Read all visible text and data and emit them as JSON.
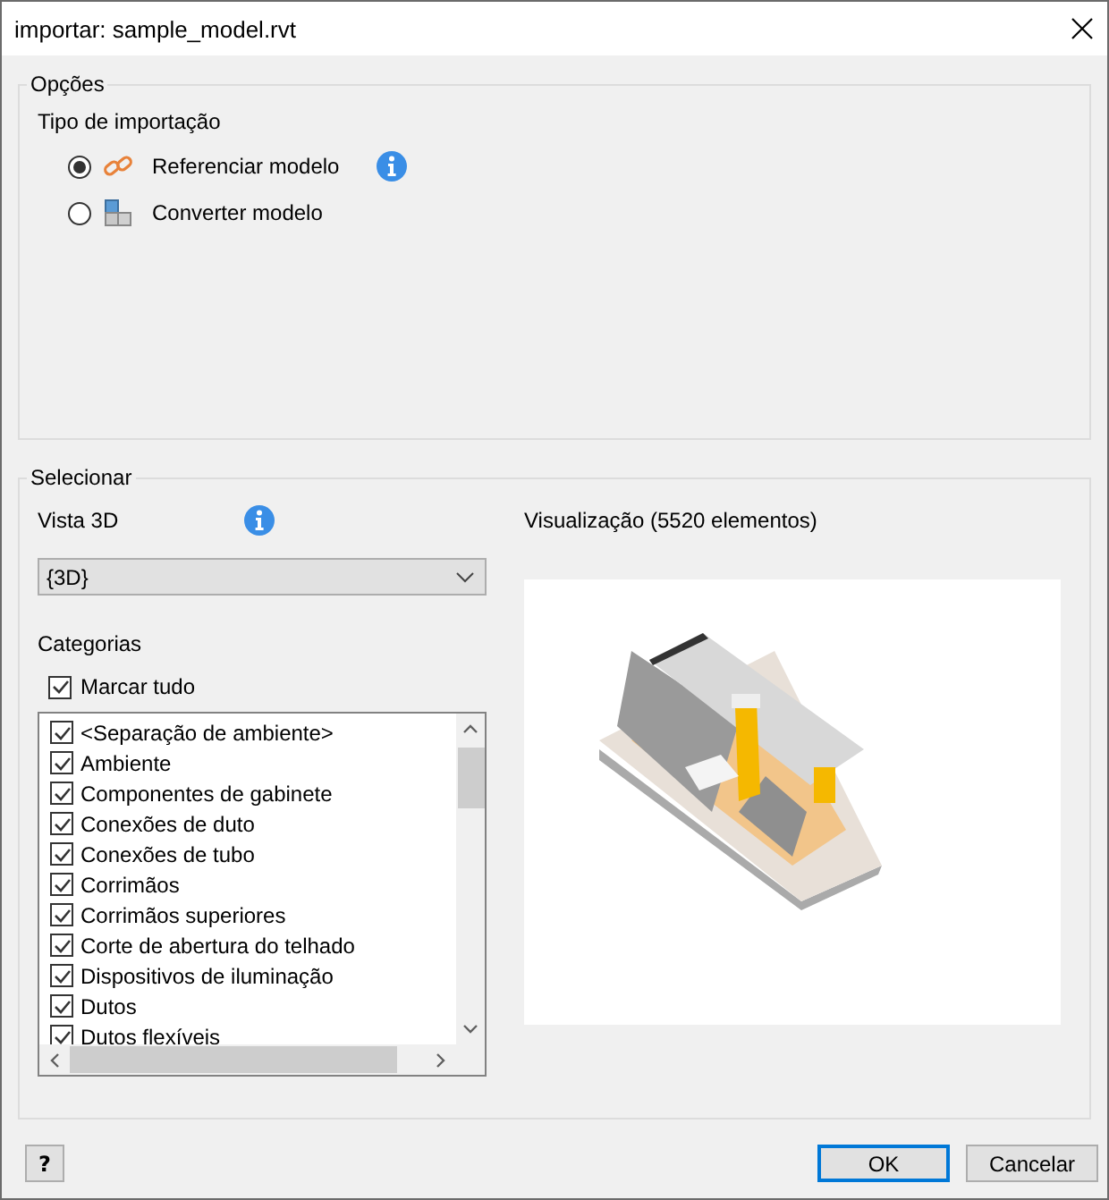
{
  "window": {
    "title": "importar: sample_model.rvt"
  },
  "options": {
    "title": "Opções",
    "import_type": {
      "label": "Tipo de importação",
      "choices": [
        {
          "label": "Referenciar modelo",
          "selected": true,
          "kind": "link",
          "info": true
        },
        {
          "label": "Converter modelo",
          "selected": false,
          "kind": "blocks",
          "info": false
        }
      ]
    }
  },
  "select": {
    "title": "Selecionar",
    "view_3d": {
      "label": "Vista 3D",
      "info": true,
      "value": "{3D}"
    },
    "categories": {
      "label": "Categorias",
      "check_all": {
        "label": "Marcar tudo",
        "checked": true
      },
      "items": [
        {
          "label": "<Separação de ambiente>",
          "checked": true
        },
        {
          "label": "Ambiente",
          "checked": true
        },
        {
          "label": "Componentes de gabinete",
          "checked": true
        },
        {
          "label": "Conexões de duto",
          "checked": true
        },
        {
          "label": "Conexões de tubo",
          "checked": true
        },
        {
          "label": "Corrimãos",
          "checked": true
        },
        {
          "label": "Corrimãos superiores",
          "checked": true
        },
        {
          "label": "Corte de abertura do telhado",
          "checked": true
        },
        {
          "label": "Dispositivos de iluminação",
          "checked": true
        },
        {
          "label": "Dutos",
          "checked": true
        },
        {
          "label": "Dutos flexíveis",
          "checked": true
        }
      ]
    },
    "preview": {
      "label": "Visualização (5520 elementos)",
      "kind": "picture"
    }
  },
  "help_button": {
    "label": "?"
  },
  "buttons": [
    {
      "label": "OK",
      "default": true
    },
    {
      "label": "Cancelar",
      "default": false
    }
  ]
}
